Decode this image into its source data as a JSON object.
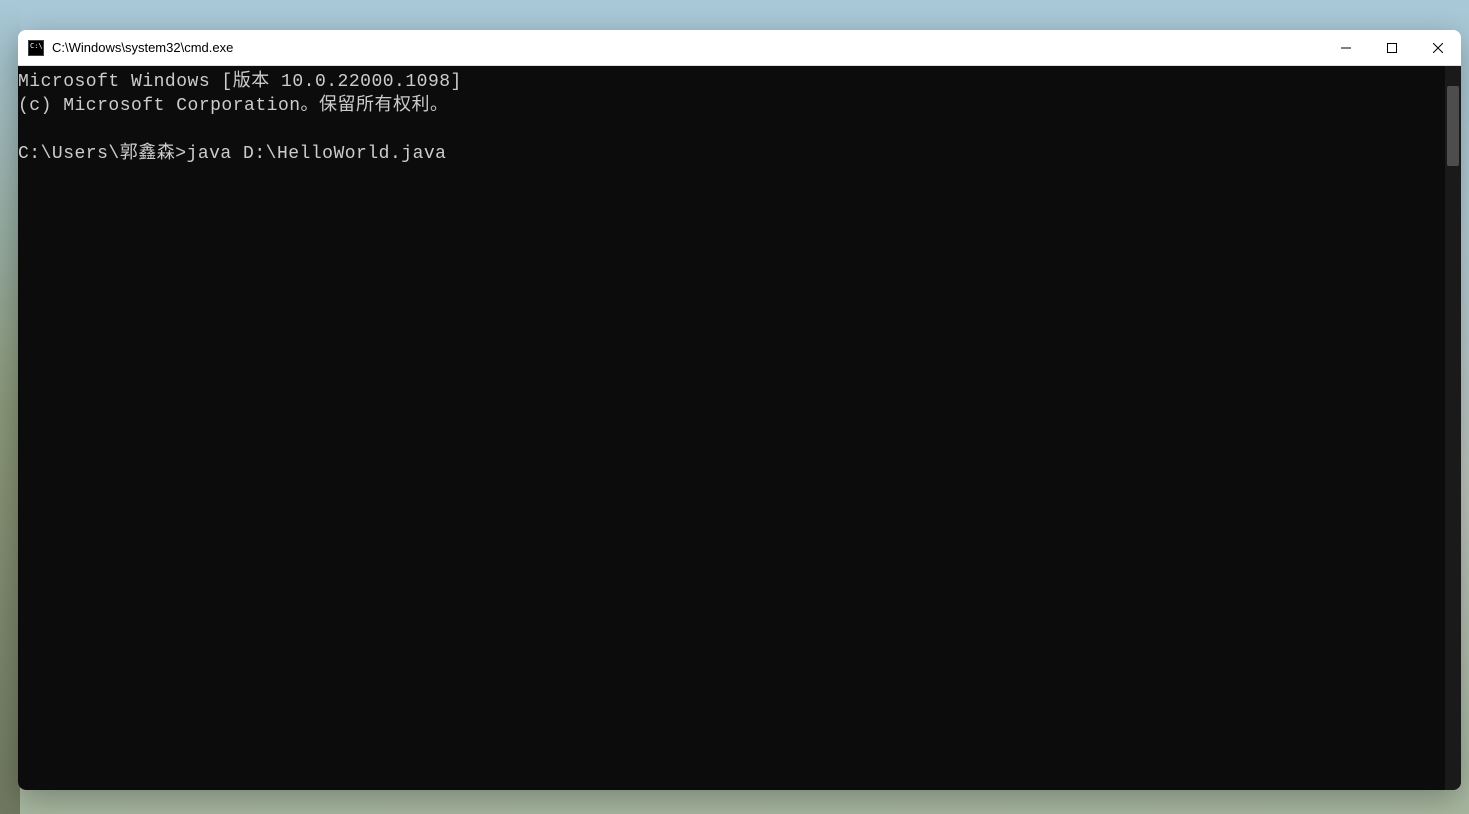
{
  "window": {
    "title": "C:\\Windows\\system32\\cmd.exe"
  },
  "terminal": {
    "line1": "Microsoft Windows [版本 10.0.22000.1098]",
    "line2": "(c) Microsoft Corporation。保留所有权利。",
    "prompt": "C:\\Users\\郭鑫森>",
    "command": "java D:\\HelloWorld.java"
  }
}
